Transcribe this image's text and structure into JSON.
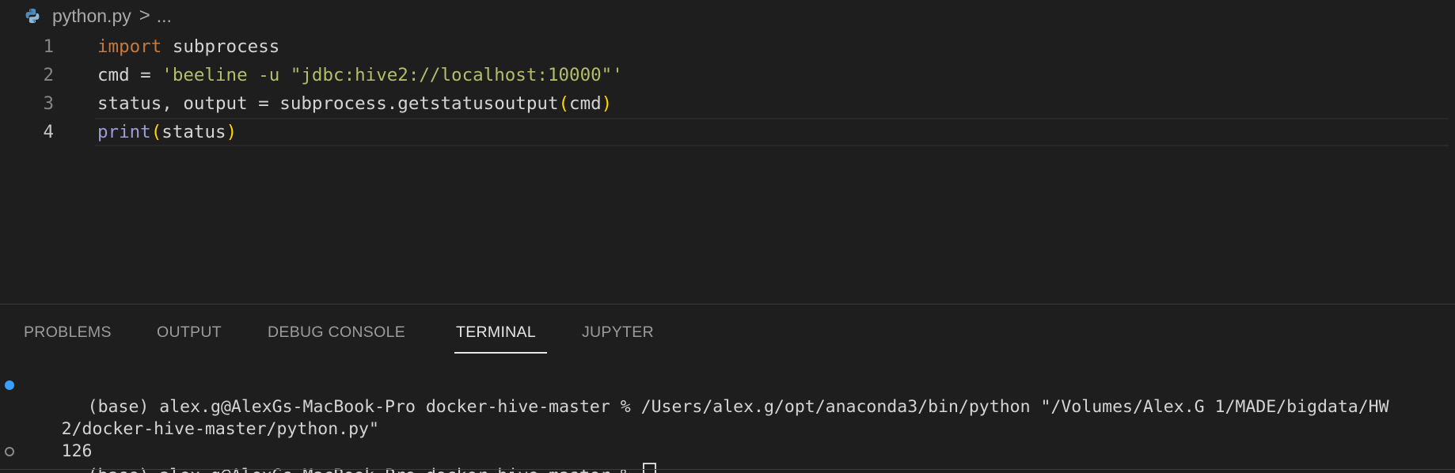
{
  "breadcrumb": {
    "file": "python.py",
    "separator": ">",
    "more": "..."
  },
  "editor": {
    "lines": [
      {
        "number": "1",
        "tokens": [
          {
            "t": "import",
            "c": "kw"
          },
          {
            "t": " subprocess",
            "c": ""
          }
        ]
      },
      {
        "number": "2",
        "tokens": [
          {
            "t": "cmd = ",
            "c": ""
          },
          {
            "t": "'beeline -u \"jdbc:hive2://localhost:10000\"'",
            "c": "str"
          }
        ]
      },
      {
        "number": "3",
        "tokens": [
          {
            "t": "status, output = subprocess.getstatusoutput",
            "c": ""
          },
          {
            "t": "(",
            "c": "paren"
          },
          {
            "t": "cmd",
            "c": ""
          },
          {
            "t": ")",
            "c": "paren"
          }
        ]
      },
      {
        "number": "4",
        "tokens": [
          {
            "t": "print",
            "c": "fn"
          },
          {
            "t": "(",
            "c": "paren"
          },
          {
            "t": "status",
            "c": ""
          },
          {
            "t": ")",
            "c": "paren"
          }
        ]
      }
    ]
  },
  "panel": {
    "tabs": [
      "PROBLEMS",
      "OUTPUT",
      "DEBUG CONSOLE",
      "TERMINAL",
      "JUPYTER"
    ],
    "active_tab": "TERMINAL"
  },
  "terminal": {
    "line1": "(base) alex.g@AlexGs-MacBook-Pro docker-hive-master % /Users/alex.g/opt/anaconda3/bin/python \"/Volumes/Alex.G 1/MADE/bigdata/HW",
    "line2": "2/docker-hive-master/python.py\"",
    "output": "126",
    "prompt": "(base) alex.g@AlexGs-MacBook-Pro docker-hive-master % "
  },
  "icons": {
    "file_icon": "python-file-icon",
    "chevron": "chevron-right-icon"
  }
}
